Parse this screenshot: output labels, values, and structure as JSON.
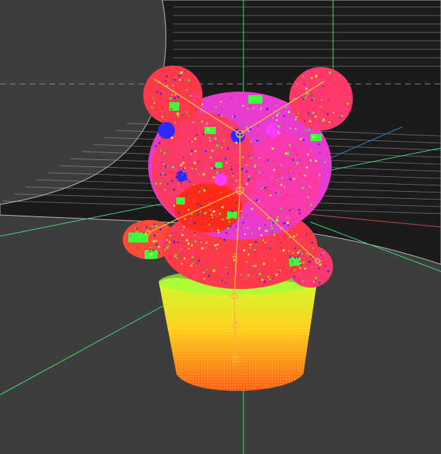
{
  "viewport": {
    "background": "#3d3d3d",
    "floor_color": "#1b1b1b",
    "floor_line_color": "#bdbdbd",
    "grid_line_color": "#3ee07a",
    "axis_x_color": "#c94a4a",
    "axis_z_color": "#3a7bd5"
  },
  "model": {
    "name": "bear-in-cup",
    "point_colors": [
      "#ff3b30",
      "#ff2fd0",
      "#3bff3b",
      "#fff23b",
      "#2b2bff"
    ],
    "rig_color": "#ffb347",
    "cup_gradient": [
      "#c8ff2a",
      "#ffd11a",
      "#ff5a14"
    ]
  }
}
